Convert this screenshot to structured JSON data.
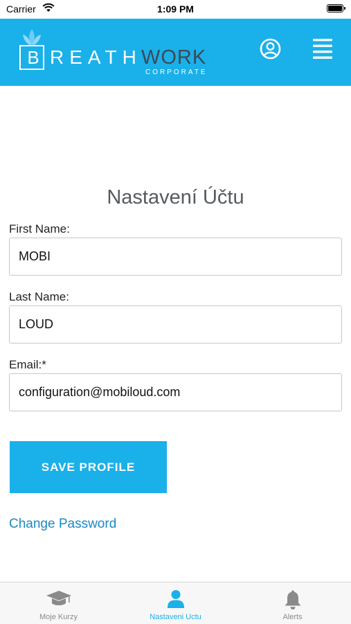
{
  "status_bar": {
    "carrier": "Carrier",
    "time": "1:09 PM"
  },
  "header": {
    "logo": {
      "box_letter": "B",
      "rest": "REATH",
      "work": "WORK",
      "corporate": "CORPORATE"
    }
  },
  "page": {
    "title": "Nastavení Účtu"
  },
  "form": {
    "first_name": {
      "label": "First Name:",
      "value": "MOBI"
    },
    "last_name": {
      "label": "Last Name:",
      "value": "LOUD"
    },
    "email": {
      "label": "Email:*",
      "value": "configuration@mobiloud.com"
    },
    "save_label": "SAVE PROFILE",
    "change_password": "Change Password"
  },
  "tabs": [
    {
      "label": "Moje Kurzy",
      "icon": "graduation-cap-icon",
      "active": false
    },
    {
      "label": "Nastaveni Uctu",
      "icon": "user-icon",
      "active": true
    },
    {
      "label": "Alerts",
      "icon": "bell-icon",
      "active": false
    }
  ],
  "colors": {
    "brand": "#1ab0ea",
    "link": "#1a88c4",
    "tab_inactive": "#8a8a8a"
  }
}
